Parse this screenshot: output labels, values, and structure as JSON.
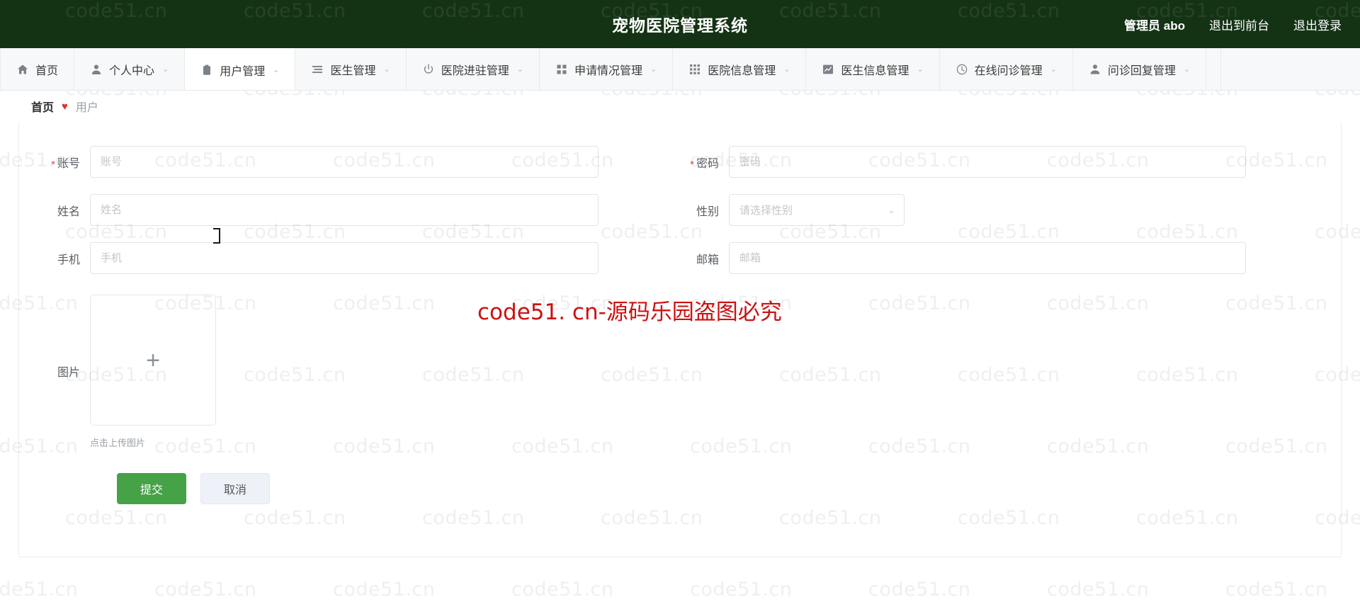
{
  "header": {
    "title": "宠物医院管理系统",
    "admin_label": "管理员 abo",
    "logout_front_label": "退出到前台",
    "logout_label": "退出登录",
    "bg_color": "#143315"
  },
  "nav": {
    "items": [
      {
        "label": "首页",
        "icon": "home-icon",
        "caret": "",
        "active": false,
        "key": "home"
      },
      {
        "label": "个人中心",
        "icon": "user-icon",
        "caret": "⌄",
        "active": false,
        "key": "personal-center"
      },
      {
        "label": "用户管理",
        "icon": "clipboard-icon",
        "caret": "⌄",
        "active": true,
        "key": "user-management"
      },
      {
        "label": "医生管理",
        "icon": "list-icon",
        "caret": "⌄",
        "active": false,
        "key": "doctor-management"
      },
      {
        "label": "医院进驻管理",
        "icon": "power-icon",
        "caret": "⌄",
        "active": false,
        "key": "hospital-entry-management"
      },
      {
        "label": "申请情况管理",
        "icon": "grid-icon",
        "caret": "⌄",
        "active": false,
        "key": "application-status-management"
      },
      {
        "label": "医院信息管理",
        "icon": "grid-dense-icon",
        "caret": "⌄",
        "active": false,
        "key": "hospital-info-management"
      },
      {
        "label": "医生信息管理",
        "icon": "chart-icon",
        "caret": "⌄",
        "active": false,
        "key": "doctor-info-management"
      },
      {
        "label": "在线问诊管理",
        "icon": "clock-icon",
        "caret": "⌄",
        "active": false,
        "key": "online-consult-management"
      },
      {
        "label": "问诊回复管理",
        "icon": "person-icon",
        "caret": "⌄",
        "active": false,
        "key": "consult-reply-management"
      }
    ]
  },
  "breadcrumb": {
    "home": "首页",
    "separator": "♥",
    "current": "用户"
  },
  "form": {
    "fields": {
      "account": {
        "label": "账号",
        "placeholder": "账号",
        "value": "",
        "required": true
      },
      "password": {
        "label": "密码",
        "placeholder": "密码",
        "value": "",
        "required": true
      },
      "name": {
        "label": "姓名",
        "placeholder": "姓名",
        "value": "",
        "required": false
      },
      "gender": {
        "label": "性别",
        "placeholder": "请选择性别",
        "value": "",
        "required": false,
        "caret": "⌄"
      },
      "phone": {
        "label": "手机",
        "placeholder": "手机",
        "value": "",
        "required": false
      },
      "email": {
        "label": "邮箱",
        "placeholder": "邮箱",
        "value": "",
        "required": false
      },
      "picture": {
        "label": "图片",
        "plus": "+",
        "hint": "点击上传图片"
      }
    },
    "submit_label": "提交",
    "cancel_label": "取消",
    "submit_color": "#45a247"
  },
  "watermark": {
    "tile_text": "code51.cn",
    "red_text": "code51. cn-源码乐园盗图必究",
    "red_color": "#cc1111"
  }
}
